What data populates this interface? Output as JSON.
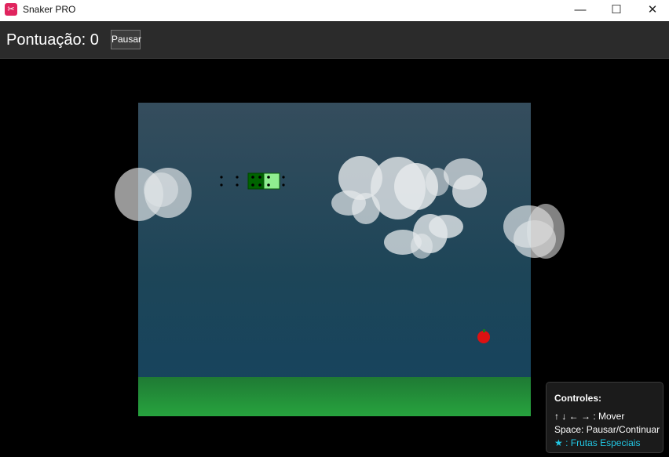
{
  "window": {
    "title": "Snaker PRO",
    "app_icon_glyph": "✂",
    "minimize_glyph": "—",
    "maximize_glyph": "☐",
    "close_glyph": "✕"
  },
  "toolbar": {
    "score_text": "Pontuação: 0",
    "pause_label": "Pausar"
  },
  "game": {
    "sky_top_color": "#354d5d",
    "sky_bottom_color": "#15445f",
    "grass_color": "#27a33e",
    "snake_head_color": "#90ee90",
    "snake_body_color": "#006400",
    "fruit_color": "#dd1111"
  },
  "controls": {
    "title": "Controles:",
    "move": "↑ ↓ ← → : Mover",
    "pause": "Space: Pausar/Continuar",
    "special": "★ : Frutas Especiais",
    "special_color": "#22c7e4"
  }
}
